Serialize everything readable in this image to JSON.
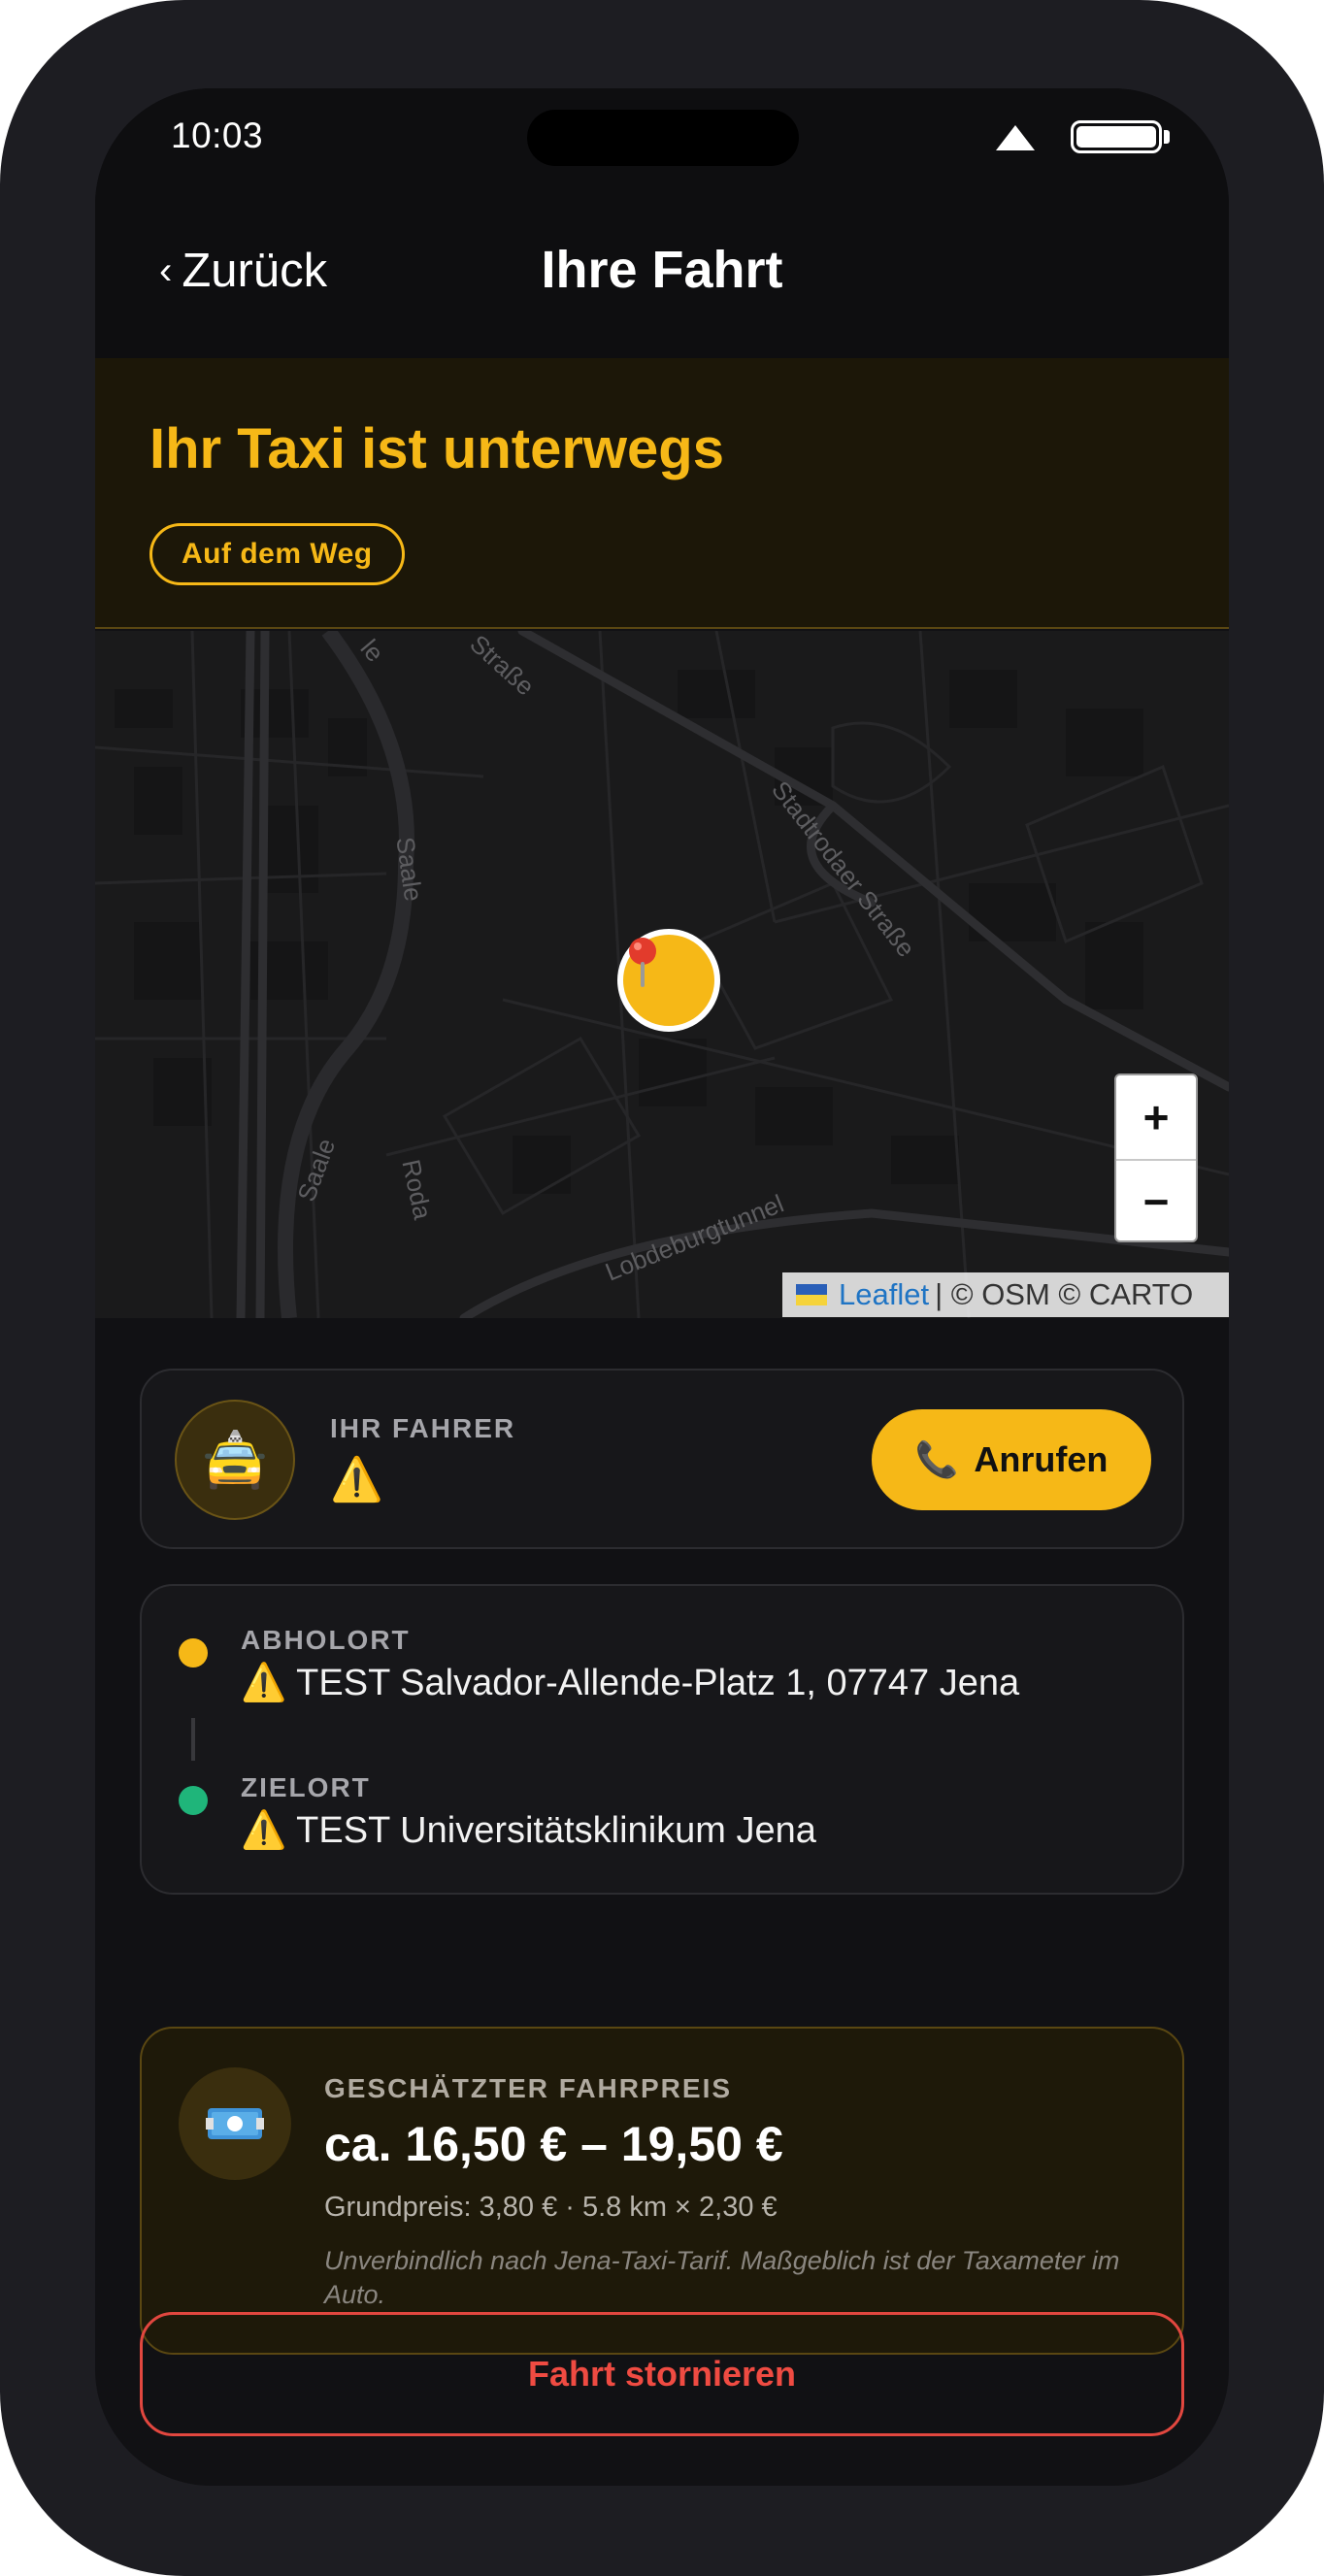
{
  "status_bar": {
    "time": "10:03"
  },
  "header": {
    "back_label": "Zurück",
    "title": "Ihre Fahrt"
  },
  "banner": {
    "title": "Ihr Taxi ist unterwegs",
    "status": "Auf dem Weg"
  },
  "map": {
    "streets": [
      "Straße",
      "Stadtrodaer Straße",
      "Saale",
      "Saale",
      "Roda",
      "Lobdeburgtunnel",
      "le"
    ],
    "zoom_in": "+",
    "zoom_out": "−",
    "attribution": {
      "leaflet": "Leaflet",
      "rest": "| © OSM © CARTO"
    }
  },
  "driver": {
    "label": "IHR FAHRER",
    "name": "⚠️",
    "avatar": "🚖",
    "call_label": "Anrufen",
    "call_icon": "📞"
  },
  "route": {
    "pickup_label": "ABHOLORT",
    "pickup_value": "⚠️ TEST Salvador-Allende-Platz 1, 07747 Jena",
    "pickup_color": "#f6b817",
    "destination_label": "ZIELORT",
    "destination_value": "⚠️ TEST Universitätsklinikum Jena",
    "destination_color": "#1fb57a"
  },
  "price": {
    "icon": "money-icon",
    "label": "GESCHÄTZTER FAHRPREIS",
    "range": "ca. 16,50 € – 19,50 €",
    "detail": "Grundpreis: 3,80 € · 5.8 km × 2,30 €",
    "note": "Unverbindlich nach Jena-Taxi-Tarif. Maßgeblich ist der Taxameter im Auto."
  },
  "cancel_label": "Fahrt stornieren",
  "colors": {
    "accent": "#f6b817",
    "danger": "#ef4b42",
    "background": "#111114"
  }
}
